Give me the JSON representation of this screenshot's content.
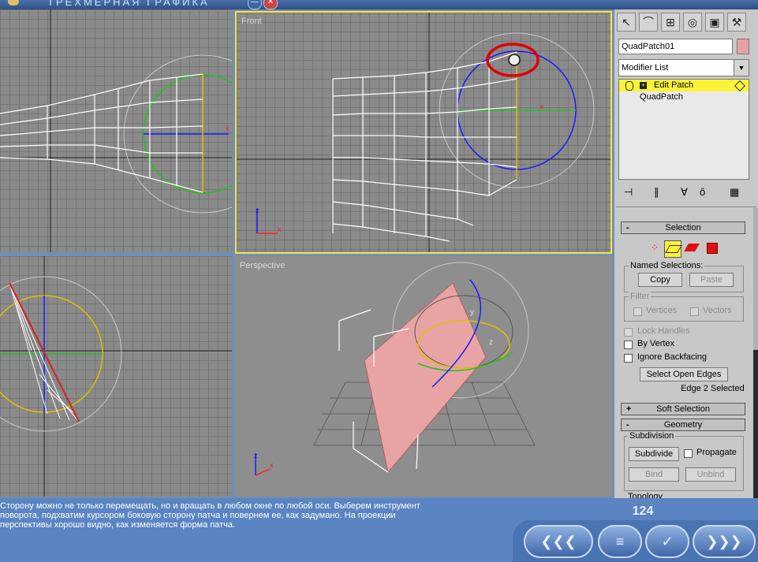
{
  "window": {
    "title": "ТРЕХМЕРНАЯ ГРАФИКА",
    "minimize_glyph": "—",
    "close_glyph": "✕"
  },
  "viewports": {
    "front_label": "Front",
    "perspective_label": "Perspective",
    "axis_x": "x",
    "axis_y": "y",
    "axis_z": "z"
  },
  "panel": {
    "tab_icons": [
      "cursor-arrow-icon",
      "bend-modifier-icon",
      "hierarchy-icon",
      "motion-icon",
      "display-icon",
      "utilities-hammer-icon"
    ],
    "object_name": "QuadPatch01",
    "object_color": "#e6a2a2",
    "modifier_list": "Modifier List",
    "stack": {
      "edit_patch": "Edit Patch",
      "quad_patch": "QuadPatch",
      "highlight_color": "#fff33a"
    },
    "selection": {
      "header": "Selection",
      "collapse_sign": "-",
      "named_selections": "Named Selections:",
      "copy": "Copy",
      "paste": "Paste",
      "filter": "Filter",
      "vertices": "Vertices",
      "vectors": "Vectors",
      "lock_handles": "Lock Handles",
      "by_vertex": "By Vertex",
      "ignore_backfacing": "Ignore Backfacing",
      "select_open_edges": "Select Open Edges",
      "status": "Edge 2 Selected"
    },
    "soft_selection": {
      "header": "Soft Selection",
      "expand_sign": "+"
    },
    "geometry": {
      "header": "Geometry",
      "collapse_sign": "-",
      "subdivision": "Subdivision",
      "subdivide": "Subdivide",
      "propagate": "Propagate",
      "bind": "Bind",
      "unbind": "Unbind",
      "topology": "Topology"
    }
  },
  "lesson": {
    "text_line1": "Сторону можно не только перемещать, но и вращать в любом окне по любой оси. Выберем инструмент",
    "text_line2": "поворота, подхватим курсором боковую сторону патча и повернем ее, как задумано. На проекции",
    "text_line3": "перспективы хорошо видно, как изменяется форма патча.",
    "page_number": "124",
    "nav_back": "❮❮❮",
    "nav_menu": "≡",
    "nav_check": "✓",
    "nav_forward": "❯❯❯"
  }
}
